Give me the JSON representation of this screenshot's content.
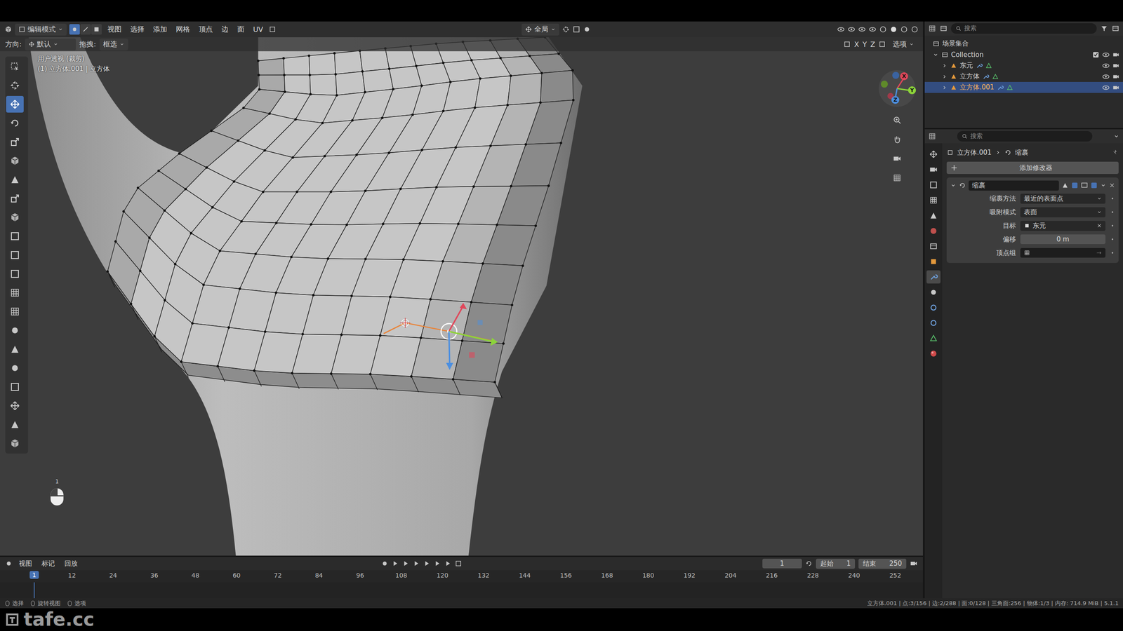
{
  "window": {
    "mode": "编辑模式",
    "menus": [
      "视图",
      "选择",
      "添加",
      "网格",
      "顶点",
      "边",
      "面",
      "UV"
    ],
    "orientation": "全局",
    "select_modes": [
      {
        "selected": true
      },
      {
        "selected": false
      },
      {
        "selected": false
      }
    ]
  },
  "tool_settings": {
    "orientation_label": "方向:",
    "orientation": "默认",
    "drag_label": "拖拽:",
    "drag": "框选",
    "axes": [
      "X",
      "Y",
      "Z"
    ],
    "options": "选项"
  },
  "viewport": {
    "view_name": "用户透视 (裁剪)",
    "object_info": "(1) 立方体.001 | 立方体",
    "gizmo_axes": [
      "X",
      "Y",
      "Z"
    ],
    "mouse_badge": "1",
    "tools": [
      {
        "selected": false
      },
      {
        "selected": false
      },
      {
        "selected": true
      },
      {
        "selected": false
      },
      {
        "selected": false
      },
      {
        "selected": false
      },
      {
        "selected": false
      },
      {
        "selected": false
      },
      {
        "selected": false
      },
      {
        "selected": false
      },
      {
        "selected": false
      },
      {
        "selected": false
      },
      {
        "selected": false
      },
      {
        "selected": false
      },
      {
        "selected": false
      },
      {
        "selected": false
      },
      {
        "selected": false
      },
      {
        "selected": false
      },
      {
        "selected": false
      },
      {
        "selected": false
      },
      {
        "selected": false
      }
    ]
  },
  "outliner": {
    "search_placeholder": "搜索",
    "scene_collection": "场景集合",
    "collection": "Collection",
    "objects": [
      {
        "name": "东元",
        "selected": false
      },
      {
        "name": "立方体",
        "selected": false
      },
      {
        "name": "立方体.001",
        "selected": true
      }
    ]
  },
  "properties": {
    "search_placeholder": "搜索",
    "breadcrumb": [
      "立方体.001",
      "缩裹"
    ],
    "add_modifier": "添加修改器",
    "tabs": [
      {
        "selected": false
      },
      {
        "selected": false
      },
      {
        "selected": false
      },
      {
        "selected": false
      },
      {
        "selected": false
      },
      {
        "selected": false
      },
      {
        "selected": false
      },
      {
        "selected": false
      },
      {
        "selected": true
      },
      {
        "selected": false
      },
      {
        "selected": false
      },
      {
        "selected": false
      },
      {
        "selected": false
      },
      {
        "selected": false
      }
    ],
    "modifier": {
      "name": "缩裹",
      "expanded": true,
      "fields": [
        {
          "label": "缩裹方法",
          "value": "最近的表面点",
          "kind": "dropdown"
        },
        {
          "label": "吸附模式",
          "value": "表面",
          "kind": "dropdown"
        },
        {
          "label": "目标",
          "value": "东元",
          "kind": "object"
        },
        {
          "label": "偏移",
          "value": "0 m",
          "kind": "number"
        },
        {
          "label": "顶点组",
          "value": "",
          "kind": "vgroup"
        }
      ]
    }
  },
  "timeline": {
    "menus": [
      "视图",
      "标记",
      "回放"
    ],
    "current_frame": "1",
    "start_label": "起始",
    "start": "1",
    "end_label": "结束",
    "end": "250",
    "ticks": [
      "1",
      "12",
      "24",
      "36",
      "48",
      "60",
      "72",
      "84",
      "96",
      "108",
      "120",
      "132",
      "144",
      "156",
      "168",
      "180",
      "192",
      "204",
      "216",
      "228",
      "240",
      "252"
    ]
  },
  "status_bar": {
    "left": [
      "选择",
      "旋转视图",
      "选项"
    ],
    "right": "立方体.001 | 点:3/156 | 边:2/288 | 面:0/128 | 三角面:256 | 物体:1/3 | 内存: 714.9 MiB | 5.1.1"
  },
  "watermark": "tafe.cc"
}
